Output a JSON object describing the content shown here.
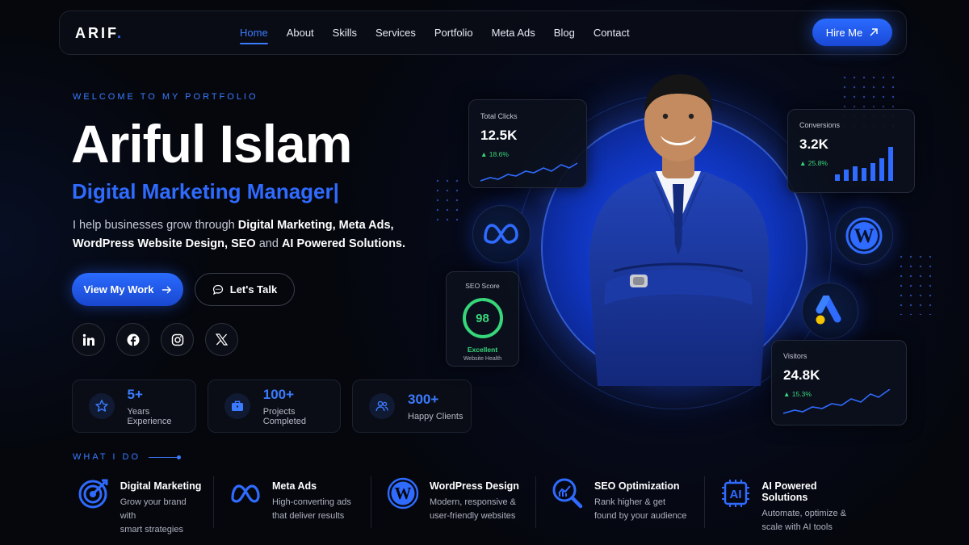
{
  "nav": {
    "logo": "ARIF",
    "logo_dot": ".",
    "links": [
      "Home",
      "About",
      "Skills",
      "Services",
      "Portfolio",
      "Meta Ads",
      "Blog",
      "Contact"
    ],
    "active": "Home",
    "hire_label": "Hire Me"
  },
  "hero": {
    "welcome": "WELCOME TO MY PORTFOLIO",
    "name": "Ariful Islam",
    "role": "Digital Marketing Manager|",
    "intro_1": "I help businesses grow through ",
    "intro_b1": "Digital Marketing, Meta Ads,",
    "intro_b2": "WordPress Website Design, SEO",
    "intro_2": " and ",
    "intro_b3": "AI Powered Solutions.",
    "primary_cta": "View My Work",
    "secondary_cta": "Let's Talk"
  },
  "social": [
    "linkedin-icon",
    "facebook-icon",
    "instagram-icon",
    "x-icon"
  ],
  "stats": [
    {
      "value": "5+",
      "label": "Years Experience",
      "icon": "star-icon"
    },
    {
      "value": "100+",
      "label": "Projects Completed",
      "icon": "briefcase-icon"
    },
    {
      "value": "300+",
      "label": "Happy Clients",
      "icon": "users-icon"
    }
  ],
  "what_i_do": {
    "title": "WHAT I DO",
    "services": [
      {
        "title": "Digital Marketing",
        "desc_1": "Grow your brand with",
        "desc_2": "smart strategies",
        "icon": "target-icon"
      },
      {
        "title": "Meta Ads",
        "desc_1": "High-converting ads",
        "desc_2": "that deliver results",
        "icon": "meta-icon"
      },
      {
        "title": "WordPress Design",
        "desc_1": "Modern, responsive &",
        "desc_2": "user-friendly websites",
        "icon": "wordpress-icon"
      },
      {
        "title": "SEO Optimization",
        "desc_1": "Rank higher & get",
        "desc_2": "found by your audience",
        "icon": "seo-search-icon"
      },
      {
        "title": "AI Powered Solutions",
        "desc_1": "Automate, optimize &",
        "desc_2": "scale with AI tools",
        "icon": "ai-chip-icon"
      }
    ]
  },
  "cards": {
    "total_clicks": {
      "label": "Total Clicks",
      "value": "12.5K",
      "delta": "▲ 18.6%"
    },
    "conversions": {
      "label": "Conversions",
      "value": "3.2K",
      "delta": "▲ 25.8%"
    },
    "seo_score": {
      "label": "SEO Score",
      "value": "98",
      "status": "Excellent",
      "sub": "Website Health",
      "fraction": 0.98
    },
    "visitors": {
      "label": "Visitors",
      "value": "24.8K",
      "delta": "▲ 15.3%"
    }
  },
  "colors": {
    "accent": "#2f6bff",
    "positive": "#37d67a",
    "background": "#05070d"
  }
}
